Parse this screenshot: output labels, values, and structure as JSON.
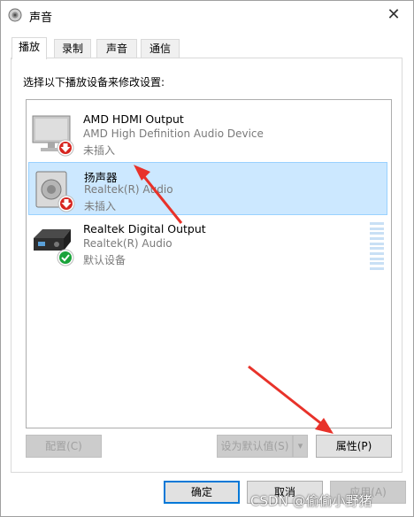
{
  "window": {
    "title": "声音",
    "close_glyph": "✕"
  },
  "tabs": [
    "播放",
    "录制",
    "声音",
    "通信"
  ],
  "instruction": "选择以下播放设备来修改设置:",
  "devices": [
    {
      "name": "AMD HDMI Output",
      "desc": "AMD High Definition Audio Device",
      "status": "未插入",
      "icon": "monitor-icon",
      "badge": "red-down-arrow-badge"
    },
    {
      "name": "扬声器",
      "desc": "Realtek(R) Audio",
      "status": "未插入",
      "icon": "speaker-icon",
      "badge": "red-down-arrow-badge"
    },
    {
      "name": "Realtek Digital Output",
      "desc": "Realtek(R) Audio",
      "status": "默认设备",
      "icon": "receiver-icon",
      "badge": "green-check-badge"
    }
  ],
  "buttons": {
    "configure": "配置(C)",
    "set_default": "设为默认值(S)",
    "set_default_dropdown": "▾",
    "properties": "属性(P)",
    "ok": "确定",
    "cancel": "取消",
    "apply": "应用(A)"
  },
  "watermark": "CSDN @偷偷小野猪",
  "colors": {
    "selection": "#cce8ff",
    "focus_border": "#0078d7",
    "annotation_arrow": "#e8322a",
    "default_badge": "#1aa33a",
    "unplugged_badge": "#d6251f"
  }
}
